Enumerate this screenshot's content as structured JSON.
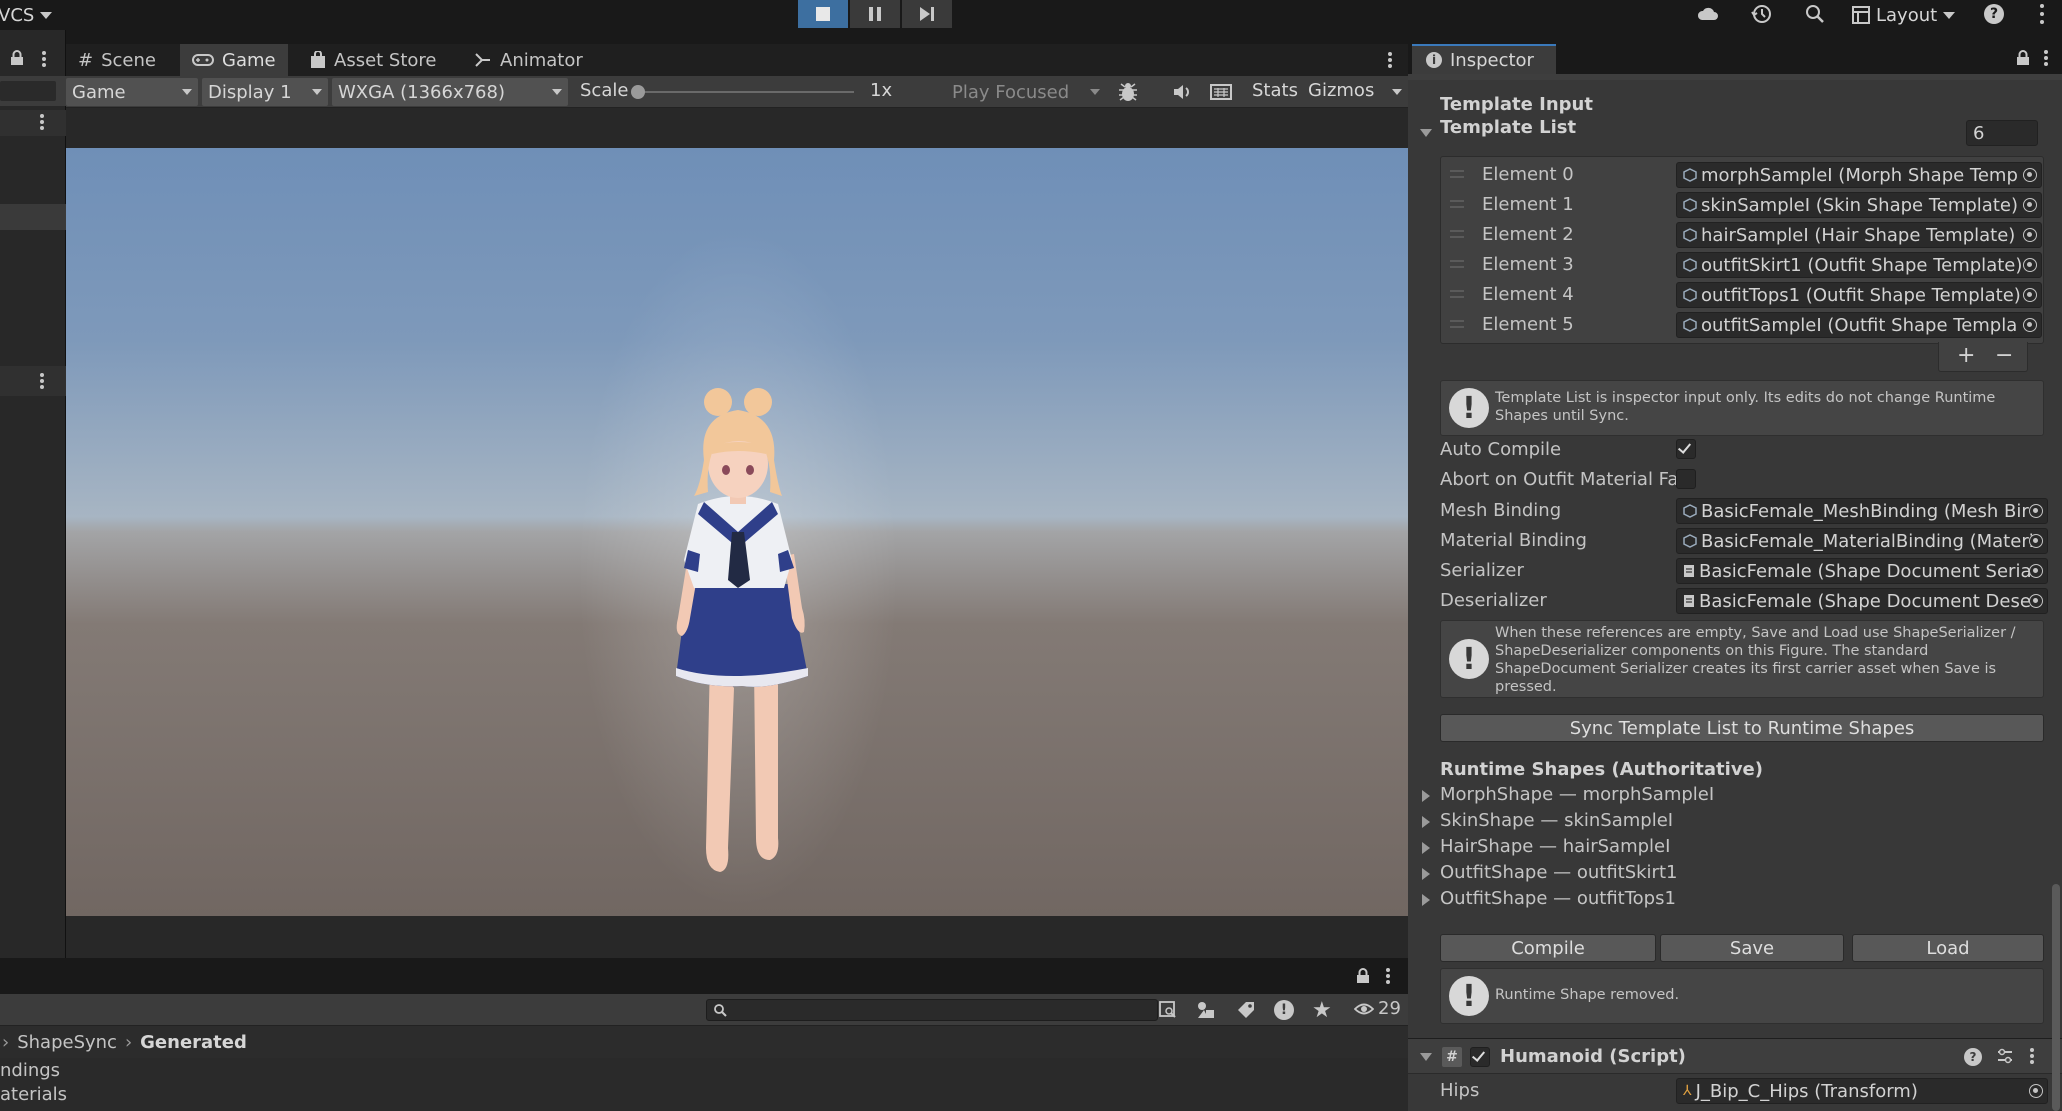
{
  "toolbar": {
    "vcs_label": "VCS",
    "layout_label": "Layout"
  },
  "game_view": {
    "tabs": [
      {
        "label": "Scene",
        "icon": "grid-icon"
      },
      {
        "label": "Game",
        "icon": "gamepad-icon"
      },
      {
        "label": "Asset Store",
        "icon": "bag-icon"
      },
      {
        "label": "Animator",
        "icon": "animator-icon"
      }
    ],
    "display_mode": "Game",
    "display": "Display 1",
    "resolution": "WXGA (1366x768)",
    "scale_label": "Scale",
    "scale_value": "1x",
    "scale_fraction": 0,
    "play_mode": "Play Focused",
    "stats_label": "Stats",
    "gizmos_label": "Gizmos"
  },
  "project": {
    "breadcrumb": [
      "ShapeSync",
      "Generated"
    ],
    "items": [
      "ndings",
      "aterials"
    ],
    "hidden_count": "29"
  },
  "inspector": {
    "tab_label": "Inspector",
    "template_input_header": "Template Input",
    "template_list_label": "Template List",
    "template_list_count": "6",
    "elements": [
      {
        "label": "Element 0",
        "value": "morphSampleI (Morph Shape Temp"
      },
      {
        "label": "Element 1",
        "value": "skinSampleI (Skin Shape Template)"
      },
      {
        "label": "Element 2",
        "value": "hairSampleI (Hair Shape Template)"
      },
      {
        "label": "Element 3",
        "value": "outfitSkirt1 (Outfit Shape Template)"
      },
      {
        "label": "Element 4",
        "value": "outfitTops1 (Outfit Shape Template)"
      },
      {
        "label": "Element 5",
        "value": "outfitSampleI (Outfit Shape Templa"
      }
    ],
    "add_symbol": "+",
    "remove_symbol": "−",
    "help_template": "Template List is inspector input only. Its edits do not change Runtime Shapes until Sync.",
    "auto_compile_label": "Auto Compile",
    "auto_compile_checked": true,
    "abort_label": "Abort on Outfit Material Fail",
    "abort_checked": false,
    "fields": [
      {
        "label": "Mesh Binding",
        "value": "BasicFemale_MeshBinding (Mesh Bir",
        "icon": "mesh-binding-icon"
      },
      {
        "label": "Material Binding",
        "value": "BasicFemale_MaterialBinding (Materi",
        "icon": "material-binding-icon"
      },
      {
        "label": "Serializer",
        "value": "BasicFemale (Shape Document Seria",
        "icon": "document-icon"
      },
      {
        "label": "Deserializer",
        "value": "BasicFemale (Shape Document Dese",
        "icon": "document-icon"
      }
    ],
    "help_refs": "When these references are empty, Save and Load use ShapeSerializer / ShapeDeserializer components on this Figure. The standard ShapeDocument Serializer creates its first carrier asset when Save is pressed.",
    "sync_button": "Sync Template List to Runtime Shapes",
    "runtime_header": "Runtime Shapes (Authoritative)",
    "runtime_items": [
      "MorphShape — morphSampleI",
      "SkinShape — skinSampleI",
      "HairShape — hairSampleI",
      "OutfitShape — outfitSkirt1",
      "OutfitShape — outfitTops1"
    ],
    "compile_button": "Compile",
    "save_button": "Save",
    "load_button": "Load",
    "help_runtime": "Runtime Shape removed.",
    "humanoid_title": "Humanoid (Script)",
    "hips_label": "Hips",
    "hips_value": "J_Bip_C_Hips (Transform)"
  }
}
